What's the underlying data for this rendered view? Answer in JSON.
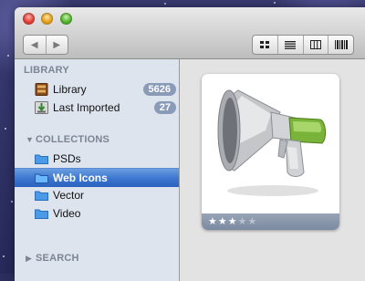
{
  "window": {
    "title": ""
  },
  "toolbar": {
    "back_icon": "chevron-left-icon",
    "forward_icon": "chevron-right-icon",
    "view_modes": [
      "grid-view-icon",
      "list-view-icon",
      "columns-view-icon",
      "barcode-view-icon"
    ]
  },
  "sidebar": {
    "library_header": "LIBRARY",
    "library_items": [
      {
        "label": "Library",
        "count": "5626",
        "icon": "library-book-icon"
      },
      {
        "label": "Last Imported",
        "count": "27",
        "icon": "import-icon"
      }
    ],
    "collections_header": "COLLECTIONS",
    "collections": [
      {
        "label": "PSDs",
        "icon": "folder-icon",
        "selected": false
      },
      {
        "label": "Web Icons",
        "icon": "folder-icon",
        "selected": true
      },
      {
        "label": "Vector",
        "icon": "folder-icon",
        "selected": false
      },
      {
        "label": "Video",
        "icon": "folder-icon",
        "selected": false
      }
    ],
    "search_header": "SEARCH"
  },
  "content": {
    "items": [
      {
        "icon": "megaphone-icon",
        "rating": 3,
        "rating_max": 5
      }
    ]
  },
  "colors": {
    "selection": "#3b75cf",
    "badge": "#8a9bb7",
    "sidebar_bg": "#dde4ee",
    "card_footer": "#7b8aa1"
  }
}
